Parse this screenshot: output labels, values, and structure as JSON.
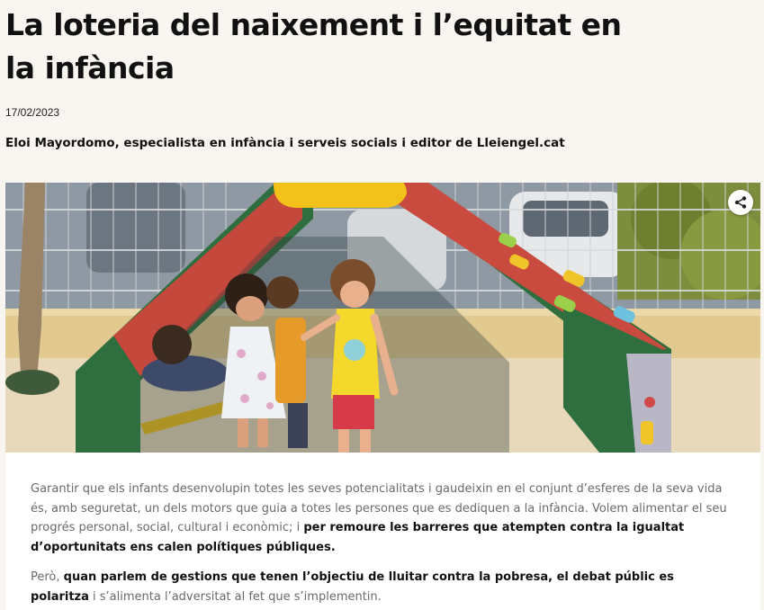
{
  "article": {
    "title": "La loteria del naixement i l’equitat en la infància",
    "date": "17/02/2023",
    "author": "Eloi Mayordomo, especialista en infància i serveis socials i editor de Lleiengel.cat",
    "hero_image": {
      "share_icon": "share-icon"
    },
    "paragraphs": [
      {
        "plain_1": "Garantir que els infants desenvolupin totes les seves potencialitats i gaudeixin en el conjunt d’esferes de la seva vida és, amb seguretat, un dels motors que guia a totes les persones que es dediquen a la infància. Volem alimentar el seu progrés personal, social, cultural i econòmic; i ",
        "bold_1": "per remoure les barreres que atempten contra la igualtat d’oportunitats ens calen polítiques públiques."
      },
      {
        "plain_1": "Però, ",
        "bold_1": "quan parlem de gestions que tenen l’objectiu de lluitar contra la pobresa, el debat públic es polaritza",
        "plain_2": " i s’alimenta l’adversitat al fet que s’implementin."
      }
    ]
  },
  "colors": {
    "page_bg": "#f9f5f0",
    "article_bg": "#ffffff",
    "body_text": "#6a6a6a",
    "bold_text": "#111111"
  }
}
